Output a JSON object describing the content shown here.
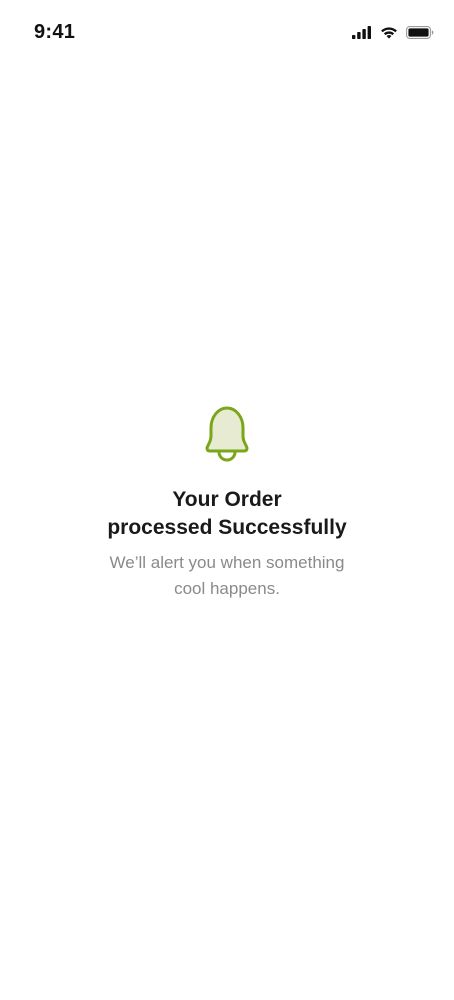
{
  "status_bar": {
    "time": "9:41",
    "icons": [
      "cellular-signal-icon",
      "wifi-icon",
      "battery-icon"
    ]
  },
  "notification": {
    "icon": "bell-icon",
    "title_line1": "Your Order",
    "title_line2": "processed Successfully",
    "subtitle_line1": "We’ll alert you when something",
    "subtitle_line2": "cool happens."
  },
  "colors": {
    "accent": "#7aa61a",
    "accent_fill": "#e6ebd2",
    "title": "#1a1a1a",
    "subtitle": "#8a8a8a",
    "background": "#ffffff"
  }
}
